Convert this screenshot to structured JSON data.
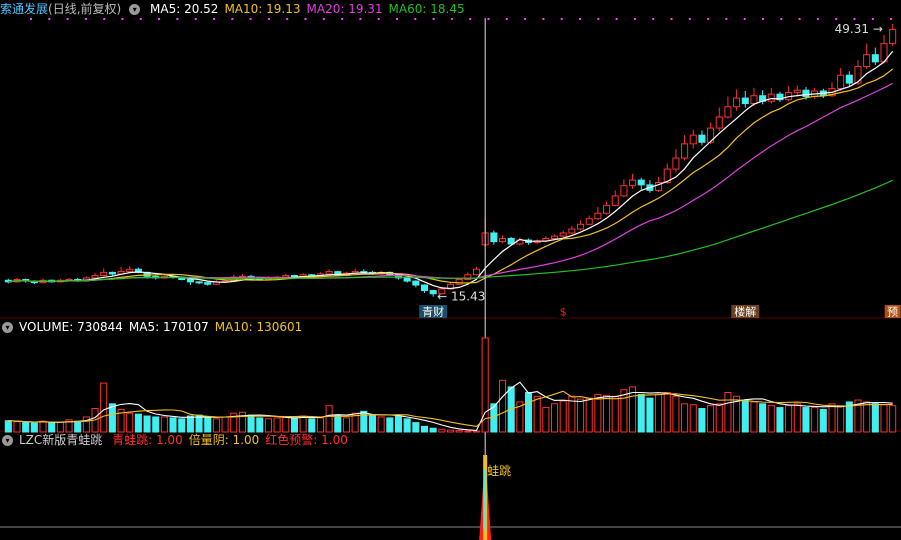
{
  "header": {
    "stock_name": "索通发展",
    "period": "(日线,前复权)",
    "ma_items": [
      {
        "label": "MA5:",
        "value": "20.52",
        "color": "#ffffff"
      },
      {
        "label": "MA10:",
        "value": "19.13",
        "color": "#f0c020"
      },
      {
        "label": "MA20:",
        "value": "19.31",
        "color": "#e040e0"
      },
      {
        "label": "MA60:",
        "value": "18.45",
        "color": "#20c020"
      }
    ]
  },
  "volume_header": {
    "items": [
      {
        "label": "VOLUME:",
        "value": "730844",
        "color": "#ffffff"
      },
      {
        "label": "MA5:",
        "value": "170107",
        "color": "#ffffff"
      },
      {
        "label": "MA10:",
        "value": "130601",
        "color": "#f0c020"
      }
    ]
  },
  "indicator_header": {
    "name": "LZC新版青蛙跳",
    "items": [
      {
        "label": "青蛙跳:",
        "value": "1.00",
        "color": "#ff3030"
      },
      {
        "label": "倍量阴:",
        "value": "1.00",
        "color": "#f0c020"
      },
      {
        "label": "红色预警:",
        "value": "1.00",
        "color": "#ff3030"
      }
    ]
  },
  "chart_data": {
    "type": "candlestick",
    "max_label": "49.31",
    "min_label": "15.43",
    "candles": [
      [
        17.5,
        17.3,
        17.7,
        17.1
      ],
      [
        17.3,
        17.6,
        17.8,
        17.2
      ],
      [
        17.6,
        17.4,
        17.7,
        17.2
      ],
      [
        17.4,
        17.2,
        17.5,
        17.0
      ],
      [
        17.2,
        17.5,
        17.7,
        17.1
      ],
      [
        17.5,
        17.3,
        17.6,
        17.2
      ],
      [
        17.3,
        17.5,
        17.7,
        17.2
      ],
      [
        17.5,
        17.6,
        17.8,
        17.4
      ],
      [
        17.6,
        17.4,
        17.8,
        17.3
      ],
      [
        17.4,
        17.8,
        18.0,
        17.3
      ],
      [
        17.8,
        18.1,
        18.4,
        17.7
      ],
      [
        18.1,
        18.5,
        19.0,
        18.0
      ],
      [
        18.5,
        18.3,
        18.6,
        18.1
      ],
      [
        18.3,
        18.6,
        19.2,
        18.2
      ],
      [
        18.6,
        18.9,
        19.3,
        18.5
      ],
      [
        18.9,
        18.5,
        19.1,
        18.4
      ],
      [
        18.5,
        18.0,
        18.6,
        17.7
      ],
      [
        18.0,
        17.8,
        18.2,
        17.6
      ],
      [
        17.8,
        18.0,
        18.2,
        17.7
      ],
      [
        18.0,
        17.9,
        18.1,
        17.7
      ],
      [
        17.9,
        17.6,
        18.0,
        17.5
      ],
      [
        17.6,
        17.3,
        17.7,
        16.9
      ],
      [
        17.3,
        17.2,
        17.4,
        17.0
      ],
      [
        17.2,
        17.0,
        17.3,
        16.8
      ],
      [
        17.0,
        17.3,
        17.5,
        16.9
      ],
      [
        17.3,
        17.4,
        17.6,
        17.2
      ],
      [
        17.4,
        17.9,
        18.2,
        17.3
      ],
      [
        17.9,
        18.0,
        18.3,
        17.8
      ],
      [
        18.0,
        17.8,
        18.2,
        17.6
      ],
      [
        17.8,
        17.6,
        17.9,
        17.5
      ],
      [
        17.6,
        17.8,
        18.0,
        17.5
      ],
      [
        17.8,
        17.9,
        18.1,
        17.7
      ],
      [
        17.9,
        18.1,
        18.3,
        17.8
      ],
      [
        18.1,
        17.9,
        18.2,
        17.7
      ],
      [
        17.9,
        18.2,
        18.4,
        17.8
      ],
      [
        18.2,
        18.0,
        18.3,
        17.9
      ],
      [
        18.0,
        18.3,
        18.5,
        17.9
      ],
      [
        18.3,
        18.6,
        18.9,
        18.2
      ],
      [
        18.6,
        18.1,
        18.7,
        18.0
      ],
      [
        18.1,
        18.4,
        18.6,
        18.0
      ],
      [
        18.4,
        18.6,
        19.0,
        18.3
      ],
      [
        18.6,
        18.5,
        18.9,
        18.3
      ],
      [
        18.5,
        18.3,
        18.7,
        18.2
      ],
      [
        18.3,
        18.5,
        18.7,
        18.2
      ],
      [
        18.5,
        18.2,
        18.6,
        18.0
      ],
      [
        18.2,
        17.8,
        18.3,
        17.6
      ],
      [
        17.8,
        17.4,
        17.9,
        17.2
      ],
      [
        17.4,
        16.9,
        17.5,
        16.6
      ],
      [
        16.9,
        16.2,
        17.0,
        15.9
      ],
      [
        16.2,
        15.8,
        16.3,
        15.43
      ],
      [
        15.8,
        16.4,
        16.7,
        15.7
      ],
      [
        16.4,
        17.0,
        17.2,
        16.3
      ],
      [
        17.0,
        17.6,
        17.8,
        16.9
      ],
      [
        17.6,
        18.2,
        18.5,
        17.5
      ],
      [
        18.2,
        18.9,
        19.2,
        18.1
      ],
      [
        22.0,
        23.5,
        25.5,
        21.8
      ],
      [
        23.5,
        22.4,
        23.8,
        22.0
      ],
      [
        22.4,
        22.8,
        23.2,
        22.2
      ],
      [
        22.8,
        22.1,
        23.0,
        21.9
      ],
      [
        22.1,
        22.6,
        22.9,
        21.9
      ],
      [
        22.6,
        22.3,
        22.8,
        22.0
      ],
      [
        22.3,
        22.5,
        22.7,
        22.1
      ],
      [
        22.5,
        22.8,
        23.1,
        22.3
      ],
      [
        22.8,
        23.1,
        23.3,
        22.6
      ],
      [
        23.1,
        23.5,
        23.8,
        22.9
      ],
      [
        23.5,
        24.0,
        24.4,
        23.3
      ],
      [
        24.0,
        24.6,
        25.1,
        23.8
      ],
      [
        24.6,
        25.3,
        25.7,
        24.5
      ],
      [
        25.3,
        26.0,
        26.8,
        25.2
      ],
      [
        26.0,
        27.0,
        27.5,
        25.8
      ],
      [
        27.0,
        28.2,
        28.9,
        26.9
      ],
      [
        28.2,
        29.5,
        30.3,
        28.0
      ],
      [
        29.5,
        30.2,
        31.0,
        29.1
      ],
      [
        30.2,
        29.6,
        30.5,
        29.0
      ],
      [
        29.6,
        28.9,
        30.2,
        28.6
      ],
      [
        28.9,
        29.9,
        30.6,
        28.7
      ],
      [
        29.9,
        31.6,
        32.3,
        29.7
      ],
      [
        31.6,
        33.0,
        34.1,
        31.2
      ],
      [
        33.0,
        34.8,
        35.9,
        32.7
      ],
      [
        34.8,
        35.9,
        36.6,
        34.2
      ],
      [
        35.9,
        35.0,
        36.5,
        34.6
      ],
      [
        35.0,
        36.8,
        37.5,
        34.8
      ],
      [
        36.8,
        38.2,
        39.4,
        36.4
      ],
      [
        38.2,
        39.5,
        40.8,
        38.0
      ],
      [
        39.5,
        40.6,
        41.7,
        39.0
      ],
      [
        40.6,
        39.9,
        41.5,
        39.4
      ],
      [
        39.9,
        40.9,
        41.9,
        39.6
      ],
      [
        40.9,
        40.2,
        41.6,
        39.8
      ],
      [
        40.2,
        41.1,
        41.9,
        39.9
      ],
      [
        41.1,
        40.4,
        41.4,
        40.1
      ],
      [
        40.4,
        41.3,
        42.1,
        40.2
      ],
      [
        41.3,
        41.6,
        42.2,
        40.8
      ],
      [
        41.6,
        40.8,
        42.0,
        40.4
      ],
      [
        40.8,
        41.5,
        41.9,
        40.5
      ],
      [
        41.5,
        40.9,
        41.8,
        40.6
      ],
      [
        40.9,
        41.8,
        42.6,
        40.7
      ],
      [
        41.8,
        43.5,
        44.4,
        41.5
      ],
      [
        43.5,
        42.5,
        44.0,
        42.1
      ],
      [
        42.5,
        44.6,
        45.4,
        42.3
      ],
      [
        44.6,
        46.1,
        47.5,
        44.3
      ],
      [
        46.1,
        45.2,
        47.0,
        44.8
      ],
      [
        45.2,
        47.5,
        48.6,
        45.0
      ],
      [
        47.5,
        49.31,
        50.0,
        47.2
      ]
    ],
    "volume": [
      120,
      110,
      100,
      95,
      115,
      100,
      105,
      130,
      115,
      160,
      250,
      520,
      300,
      240,
      200,
      190,
      170,
      160,
      160,
      150,
      140,
      170,
      180,
      150,
      140,
      160,
      200,
      210,
      180,
      150,
      140,
      150,
      160,
      150,
      170,
      140,
      150,
      280,
      180,
      150,
      200,
      220,
      180,
      160,
      150,
      170,
      140,
      100,
      60,
      40,
      30,
      20,
      15,
      10,
      10,
      1000,
      300,
      550,
      480,
      320,
      420,
      380,
      260,
      300,
      330,
      380,
      350,
      360,
      400,
      390,
      380,
      450,
      480,
      400,
      360,
      400,
      420,
      380,
      300,
      290,
      250,
      280,
      300,
      420,
      380,
      340,
      320,
      300,
      280,
      260,
      280,
      300,
      260,
      260,
      240,
      300,
      280,
      320,
      340,
      320,
      300,
      290,
      280
    ],
    "ma_series": [
      {
        "name": "MA5",
        "color": "#ffffff",
        "period": 5
      },
      {
        "name": "MA10",
        "color": "#f0c020",
        "period": 10
      },
      {
        "name": "MA20",
        "color": "#e040e0",
        "period": 20
      },
      {
        "name": "MA60",
        "color": "#20c020",
        "period": 60
      }
    ],
    "event_labels": [
      {
        "index": 49,
        "text": "青财",
        "bg": "#1a4d66",
        "color": "#ffffff"
      },
      {
        "index": 64,
        "text": "$",
        "bg": "#000000",
        "color": "#ff2020"
      },
      {
        "index": 85,
        "text": "楼解",
        "bg": "#6a4020",
        "color": "#ffffff"
      },
      {
        "index": 102,
        "text": "预",
        "bg": "#b05010",
        "color": "#ffffff"
      }
    ],
    "frog_label": "蛙跳",
    "frog_index": 55,
    "colors": {
      "up": "#ff3030",
      "down": "#40f0f0",
      "bg": "#000000",
      "grid": "#600000"
    }
  }
}
